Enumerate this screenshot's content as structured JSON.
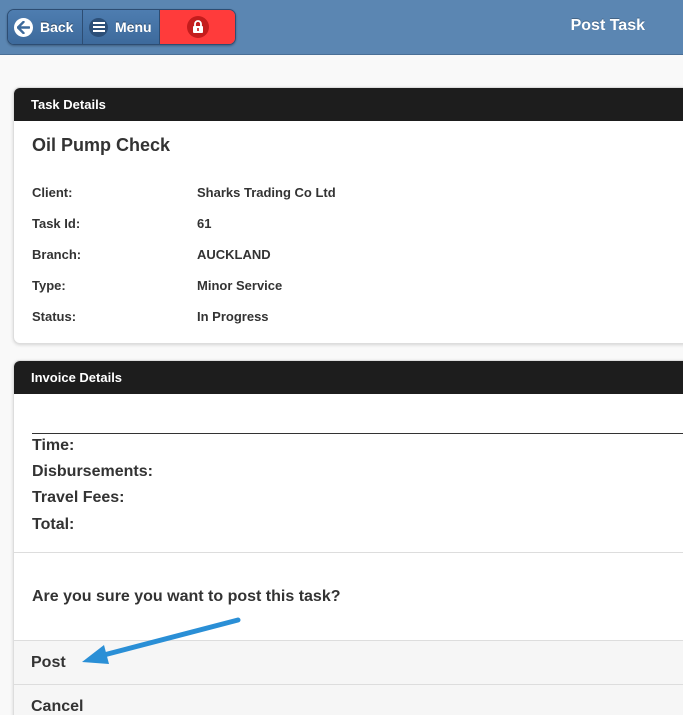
{
  "header": {
    "back_label": "Back",
    "menu_label": "Menu",
    "title": "Post Task",
    "lock_color": "#ff3b3b",
    "back_icon": "arrow-left-icon",
    "menu_icon": "hamburger-icon",
    "lock_icon": "lock-icon"
  },
  "task_details": {
    "header": "Task Details",
    "title": "Oil Pump Check",
    "rows": [
      {
        "label": "Client:",
        "value": "Sharks Trading Co Ltd"
      },
      {
        "label": "Task Id:",
        "value": "61"
      },
      {
        "label": "Branch:",
        "value": "AUCKLAND"
      },
      {
        "label": "Type:",
        "value": "Minor Service"
      },
      {
        "label": "Status:",
        "value": "In Progress"
      }
    ]
  },
  "invoice_details": {
    "header": "Invoice Details",
    "labels": [
      "Time:",
      "Disbursements:",
      "Travel Fees:",
      "Total:"
    ]
  },
  "confirm": {
    "question": "Are you sure you want to post this task?",
    "post_label": "Post",
    "cancel_label": "Cancel"
  },
  "annotation_color": "#2a8fd6"
}
